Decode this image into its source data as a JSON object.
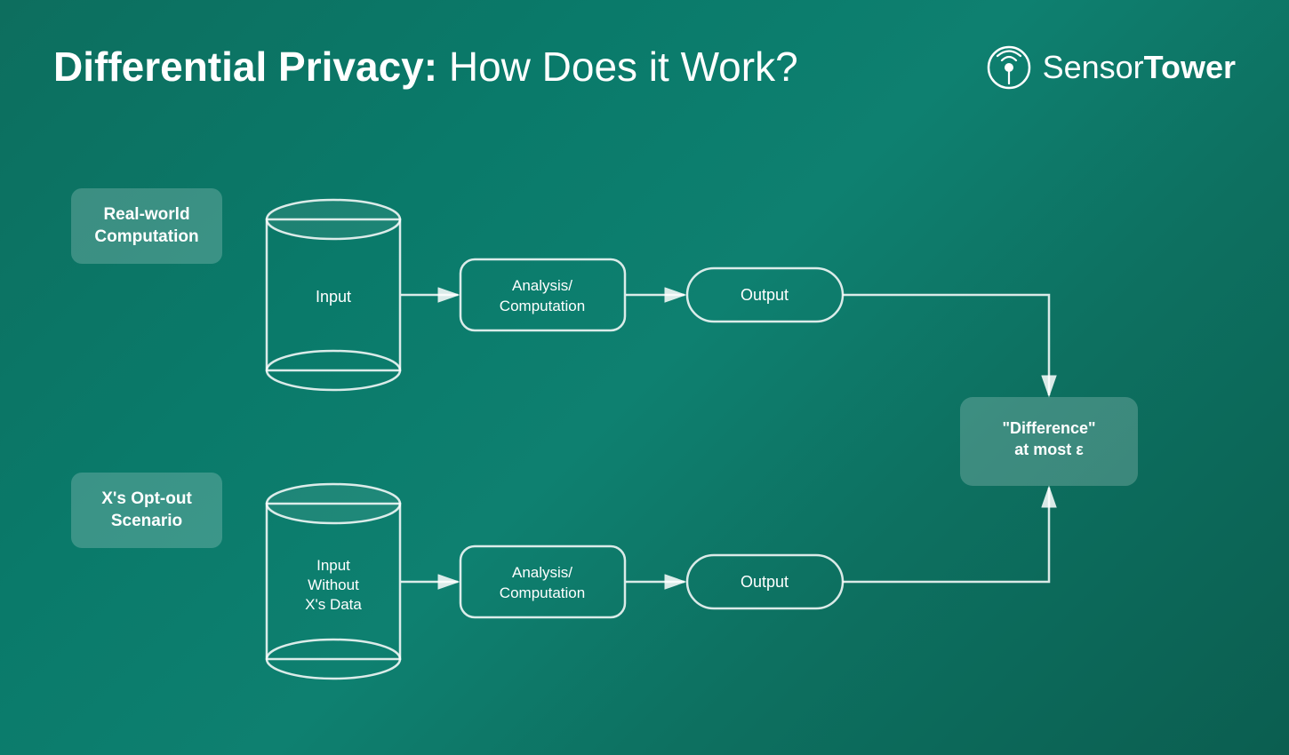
{
  "header": {
    "title_bold": "Differential Privacy:",
    "title_light": " How Does it Work?",
    "logo_sensor": "Sensor",
    "logo_tower": "Tower"
  },
  "diagram": {
    "label_real": "Real-world\nComputation",
    "label_opt": "X's Opt-out\nScenario",
    "input_top": "Input",
    "input_bottom": "Input\nWithout\nX's Data",
    "analysis_top": "Analysis/\nComputation",
    "analysis_bottom": "Analysis/\nComputation",
    "output_top": "Output",
    "output_bottom": "Output",
    "diff": "\"Difference\"\nat most ε"
  }
}
